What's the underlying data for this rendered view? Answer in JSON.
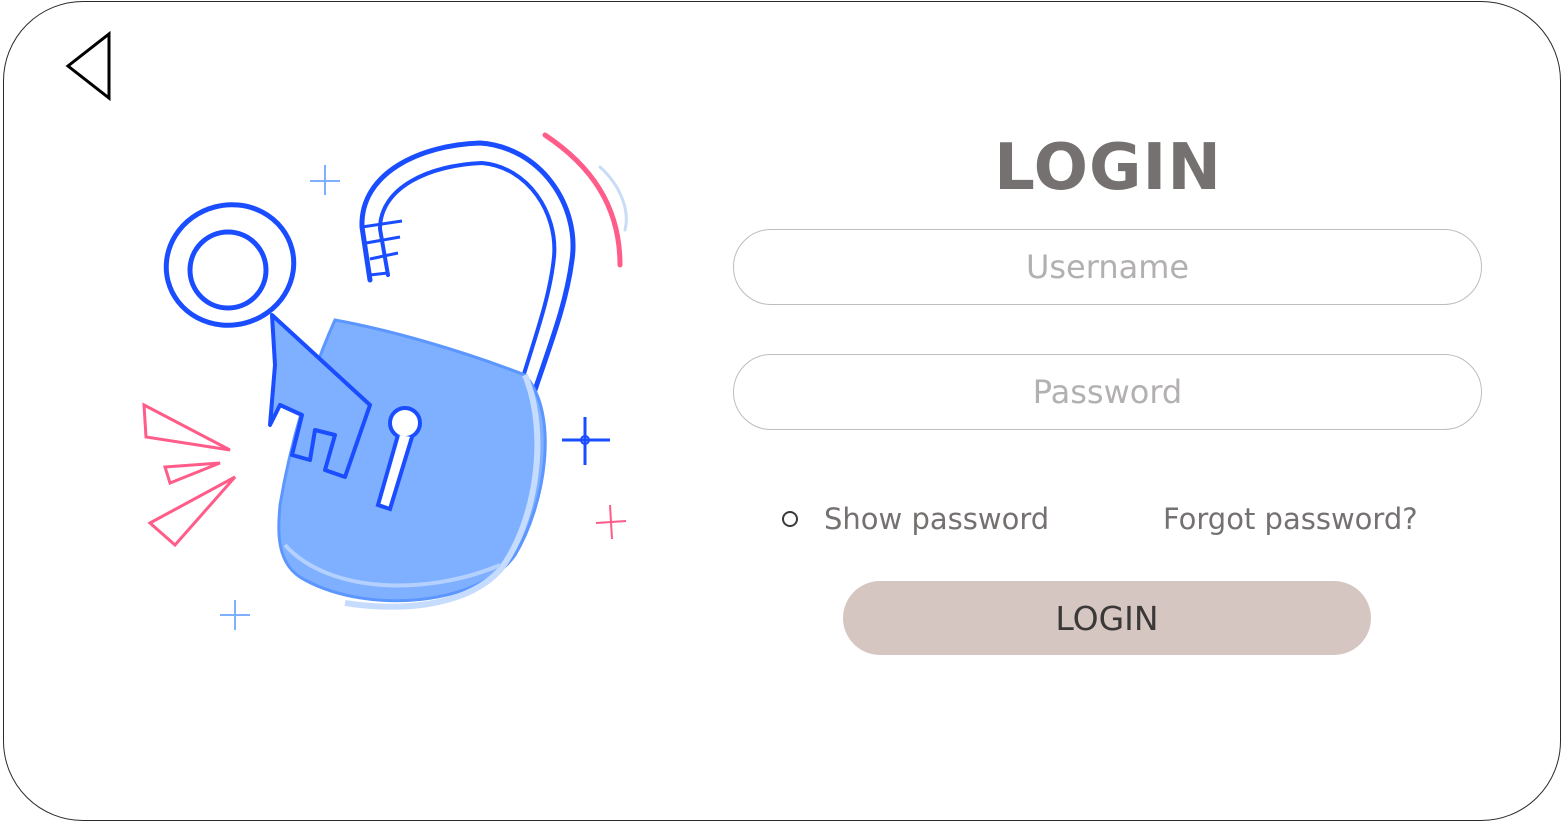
{
  "header": {
    "title": "LOGIN"
  },
  "form": {
    "username": {
      "placeholder": "Username",
      "value": ""
    },
    "password": {
      "placeholder": "Password",
      "value": ""
    },
    "show_password_label": "Show password",
    "show_password_checked": false,
    "forgot_password_label": "Forgot password?",
    "submit_label": "LOGIN"
  },
  "icons": {
    "back": "back-triangle-icon",
    "illustration": "unlocked-padlock-with-key-illustration"
  },
  "colors": {
    "title": "#757171",
    "placeholder": "#b3b0b0",
    "button_bg": "#d5c6c1",
    "illustration_blue": "#1a4dff",
    "illustration_light_blue": "#7fb0ff",
    "illustration_pink": "#ff5c8a"
  }
}
